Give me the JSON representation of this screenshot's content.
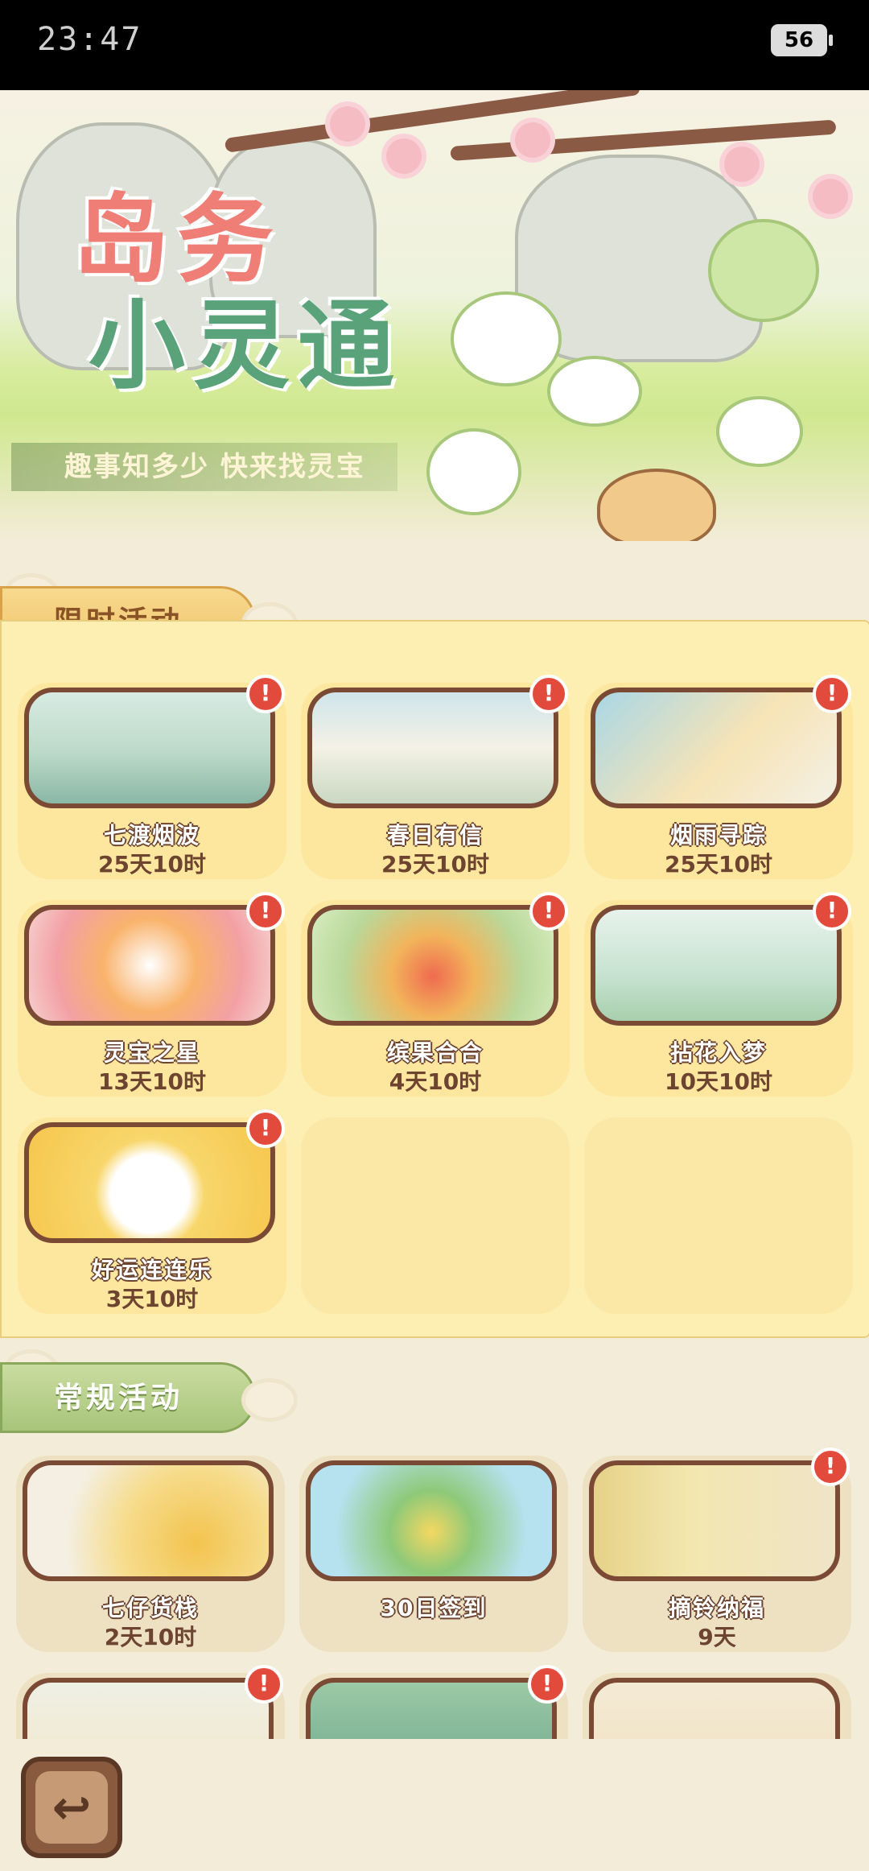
{
  "status_bar": {
    "time": "23:47",
    "battery": "56"
  },
  "banner": {
    "title_line1": "岛务",
    "title_line2": "小灵通",
    "slogan": "趣事知多少 快来找灵宝"
  },
  "limited_section": {
    "title": "限时活动",
    "cards": [
      {
        "name": "七渡烟波",
        "time": "25天10时",
        "alert": "!"
      },
      {
        "name": "春日有信",
        "time": "25天10时",
        "alert": "!"
      },
      {
        "name": "烟雨寻踪",
        "time": "25天10时",
        "alert": "!"
      },
      {
        "name": "灵宝之星",
        "time": "13天10时",
        "alert": "!"
      },
      {
        "name": "缤果合合",
        "time": "4天10时",
        "alert": "!"
      },
      {
        "name": "拈花入梦",
        "time": "10天10时",
        "alert": "!"
      },
      {
        "name": "好运连连乐",
        "time": "3天10时",
        "alert": "!"
      }
    ]
  },
  "regular_section": {
    "title": "常规活动",
    "cards": [
      {
        "name": "七仔货栈",
        "time": "2天10时"
      },
      {
        "name": "30日签到",
        "time": ""
      },
      {
        "name": "摘铃纳福",
        "time": "9天",
        "alert": "!"
      }
    ]
  },
  "colors": {
    "panel": "#fdefb1",
    "card": "#fde69e",
    "frame": "#7a4a35",
    "alert": "#e24a3c"
  },
  "icons": {
    "back": "back-arrow-icon"
  }
}
